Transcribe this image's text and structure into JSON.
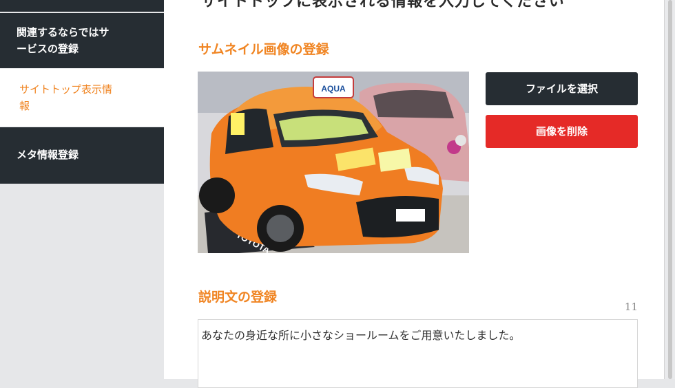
{
  "sidebar": {
    "items": [
      {
        "label_line1": "関連するならではサ",
        "label_line2": "ービスの登録",
        "active": false
      },
      {
        "label_line1": "サイトトップ表示情",
        "label_line2": "報",
        "active": true
      },
      {
        "label_line1": "メタ情報登録",
        "label_line2": "",
        "active": false
      }
    ]
  },
  "main": {
    "cut_heading": "サイトトップに表示される情報を入力してください",
    "thumbnail_section": {
      "title": "サムネイル画像の登録",
      "select_button": "ファイルを選択",
      "delete_button": "画像を削除",
      "image_brand_text": "AQUA",
      "image_mat_text": "TOYOTA"
    },
    "description_section": {
      "title": "説明文の登録",
      "char_count": "11",
      "text": "あなたの身近な所に小さなショールームをご用意いたしました。"
    }
  },
  "colors": {
    "accent": "#f08523",
    "dark": "#262d33",
    "danger": "#e52a27",
    "background": "#e6e7e9"
  }
}
